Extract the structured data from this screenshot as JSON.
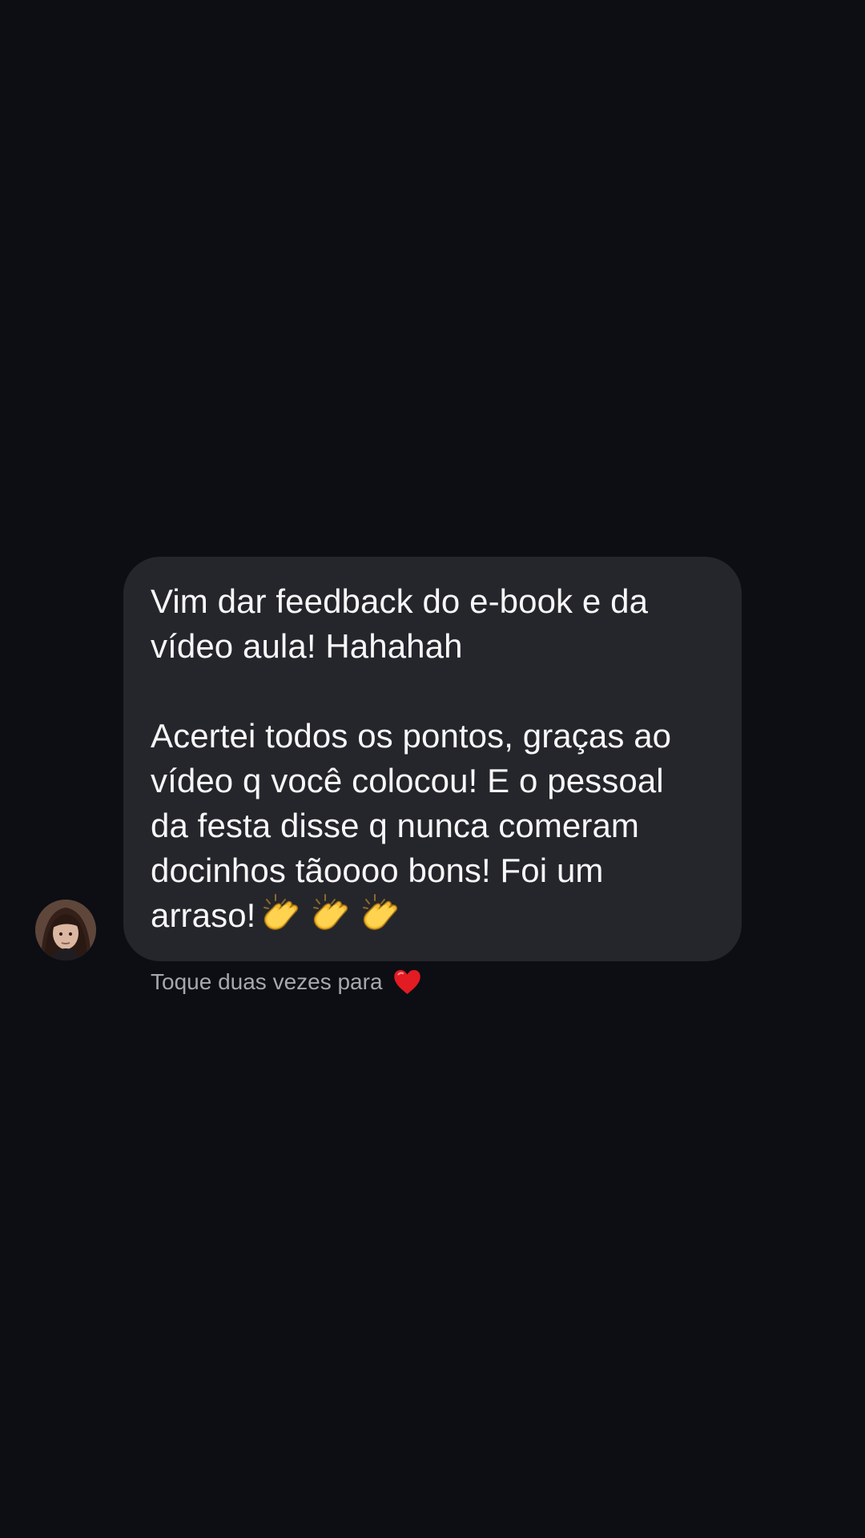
{
  "conversation": {
    "message": {
      "text_line_1": "Vim dar feedback do e-book e da",
      "text_line_2": "vídeo aula! Hahahah",
      "text_line_3": "Acertei todos os pontos, graças ao",
      "text_line_4": "vídeo q você colocou! E o pessoal",
      "text_line_5": "da festa disse q nunca comeram",
      "text_line_6": "docinhos tãoooo bons! Foi um",
      "text_line_7": "arraso!",
      "emoji_icons": [
        "clapping-hands-icon",
        "clapping-hands-icon",
        "clapping-hands-icon"
      ]
    },
    "reaction_hint": {
      "text": "Toque duas vezes para",
      "icon": "red-heart-icon"
    }
  },
  "colors": {
    "background": "#0c0e14",
    "bubble": "#25262b",
    "text": "#f7f7f8",
    "hint_text": "#a7a8ad",
    "heart": "#e31b23",
    "clap": "#f6c033"
  }
}
